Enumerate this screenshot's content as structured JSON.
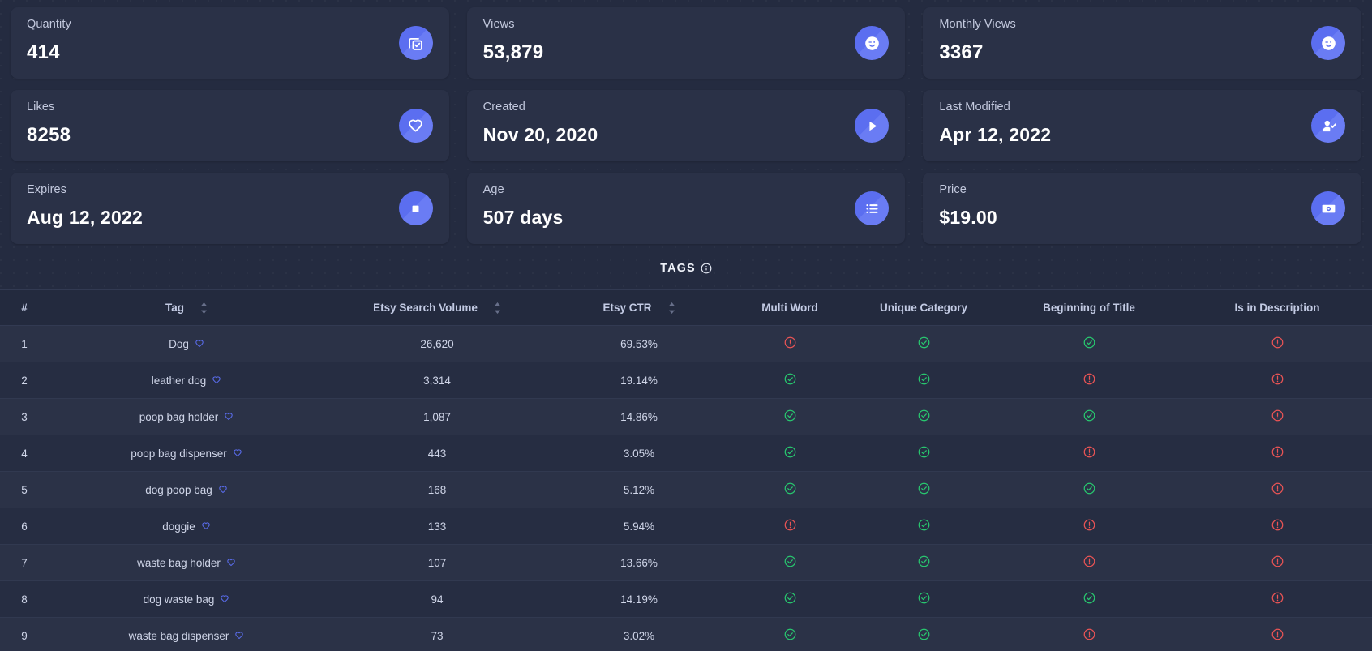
{
  "cards": [
    {
      "label": "Quantity",
      "value": "414",
      "icon": "duplicate-check-icon"
    },
    {
      "label": "Views",
      "value": "53,879",
      "icon": "smiley-wink-icon"
    },
    {
      "label": "Monthly Views",
      "value": "3367",
      "icon": "smiley-wink-icon"
    },
    {
      "label": "Likes",
      "value": "8258",
      "icon": "heart-icon"
    },
    {
      "label": "Created",
      "value": "Nov 20, 2020",
      "icon": "play-icon"
    },
    {
      "label": "Last Modified",
      "value": "Apr 12, 2022",
      "icon": "user-check-icon"
    },
    {
      "label": "Expires",
      "value": "Aug 12, 2022",
      "icon": "stop-square-icon"
    },
    {
      "label": "Age",
      "value": "507 days",
      "icon": "list-icon"
    },
    {
      "label": "Price",
      "value": "$19.00",
      "icon": "money-icon"
    }
  ],
  "tags_section": {
    "title": "TAGS",
    "info_icon": "info-icon"
  },
  "table": {
    "columns": [
      {
        "label": "#",
        "sortable": false
      },
      {
        "label": "Tag",
        "sortable": true
      },
      {
        "label": "Etsy Search Volume",
        "sortable": true
      },
      {
        "label": "Etsy CTR",
        "sortable": true
      },
      {
        "label": "Multi Word",
        "sortable": false
      },
      {
        "label": "Unique Category",
        "sortable": false
      },
      {
        "label": "Beginning of Title",
        "sortable": false
      },
      {
        "label": "Is in Description",
        "sortable": false
      }
    ],
    "rows": [
      {
        "num": "1",
        "tag": "Dog",
        "volume": "26,620",
        "ctr": "69.53%",
        "multi_word": "no",
        "unique_category": "yes",
        "beginning_of_title": "yes",
        "is_in_description": "no"
      },
      {
        "num": "2",
        "tag": "leather dog",
        "volume": "3,314",
        "ctr": "19.14%",
        "multi_word": "yes",
        "unique_category": "yes",
        "beginning_of_title": "no",
        "is_in_description": "no"
      },
      {
        "num": "3",
        "tag": "poop bag holder",
        "volume": "1,087",
        "ctr": "14.86%",
        "multi_word": "yes",
        "unique_category": "yes",
        "beginning_of_title": "yes",
        "is_in_description": "no"
      },
      {
        "num": "4",
        "tag": "poop bag dispenser",
        "volume": "443",
        "ctr": "3.05%",
        "multi_word": "yes",
        "unique_category": "yes",
        "beginning_of_title": "no",
        "is_in_description": "no"
      },
      {
        "num": "5",
        "tag": "dog poop bag",
        "volume": "168",
        "ctr": "5.12%",
        "multi_word": "yes",
        "unique_category": "yes",
        "beginning_of_title": "yes",
        "is_in_description": "no"
      },
      {
        "num": "6",
        "tag": "doggie",
        "volume": "133",
        "ctr": "5.94%",
        "multi_word": "no",
        "unique_category": "yes",
        "beginning_of_title": "no",
        "is_in_description": "no"
      },
      {
        "num": "7",
        "tag": "waste bag holder",
        "volume": "107",
        "ctr": "13.66%",
        "multi_word": "yes",
        "unique_category": "yes",
        "beginning_of_title": "no",
        "is_in_description": "no"
      },
      {
        "num": "8",
        "tag": "dog waste bag",
        "volume": "94",
        "ctr": "14.19%",
        "multi_word": "yes",
        "unique_category": "yes",
        "beginning_of_title": "yes",
        "is_in_description": "no"
      },
      {
        "num": "9",
        "tag": "waste bag dispenser",
        "volume": "73",
        "ctr": "3.02%",
        "multi_word": "yes",
        "unique_category": "yes",
        "beginning_of_title": "no",
        "is_in_description": "no"
      }
    ],
    "row_tag_icon": "heart-outline-icon",
    "status_yes_icon": "check-circle-icon",
    "status_no_icon": "alert-circle-icon"
  },
  "colors": {
    "page_background": "#242b40",
    "card_background": "#2a3147",
    "accent": "#5b6ef0",
    "status_yes": "#28c76f",
    "status_no": "#ea5455",
    "text_primary": "#ffffff",
    "text_secondary": "#c3c9de"
  }
}
